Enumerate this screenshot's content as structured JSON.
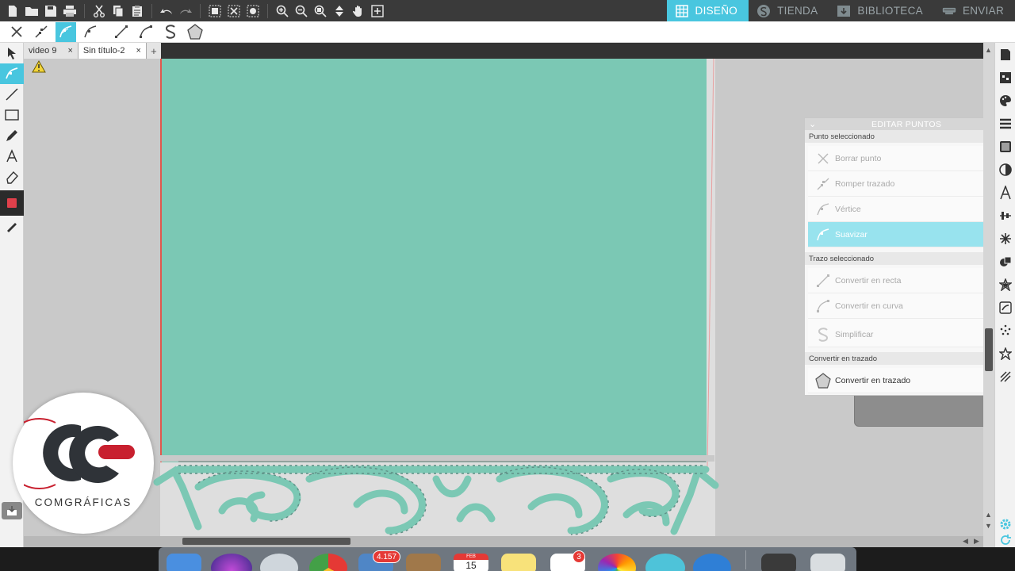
{
  "top_nav": [
    {
      "label": "DISEÑO",
      "icon": "grid-icon",
      "active": true
    },
    {
      "label": "TIENDA",
      "icon": "store-icon",
      "active": false
    },
    {
      "label": "BIBLIOTECA",
      "icon": "library-icon",
      "active": false
    },
    {
      "label": "ENVIAR",
      "icon": "send-icon",
      "active": false
    }
  ],
  "doc_tabs": [
    {
      "label": "video 9",
      "close": "×",
      "active": false
    },
    {
      "label": "Sin título-2",
      "close": "×",
      "active": true
    }
  ],
  "doc_add_label": "+",
  "panel": {
    "title": "EDITAR PUNTOS",
    "close": "×",
    "collapse": "⌄",
    "sections": {
      "selected_point": "Punto seleccionado",
      "selected_stroke": "Trazo seleccionado",
      "convert_path": "Convertir en trazado"
    },
    "point_items": [
      {
        "label": "Borrar punto",
        "icon": "delete-point-icon",
        "state": "disabled"
      },
      {
        "label": "Romper trazado",
        "icon": "break-path-icon",
        "state": "disabled"
      },
      {
        "label": "Vértice",
        "icon": "vertex-icon",
        "state": "disabled"
      },
      {
        "label": "Suavizar",
        "icon": "smooth-icon",
        "state": "active"
      }
    ],
    "stroke_items": [
      {
        "label": "Convertir en recta",
        "icon": "straight-line-icon",
        "state": "disabled"
      },
      {
        "label": "Convertir en curva",
        "icon": "curve-icon",
        "state": "disabled"
      },
      {
        "label": "Simplificar",
        "icon": "simplify-icon",
        "state": "disabled"
      }
    ],
    "path_items": [
      {
        "label": "Convertir en trazado",
        "icon": "pentagon-icon",
        "state": "enabled"
      }
    ]
  },
  "logo": {
    "text": "COMGRÁFICAS"
  },
  "dock": {
    "mail_badge": "4.157",
    "calendar_month": "FEB",
    "calendar_day": "15",
    "reminders_badge": "3"
  },
  "colors": {
    "accent": "#49c6df",
    "teal_shape": "#7bc8b4",
    "red_line": "#e0584e",
    "logo_red": "#c8202f",
    "logo_dark": "#2f3338"
  }
}
